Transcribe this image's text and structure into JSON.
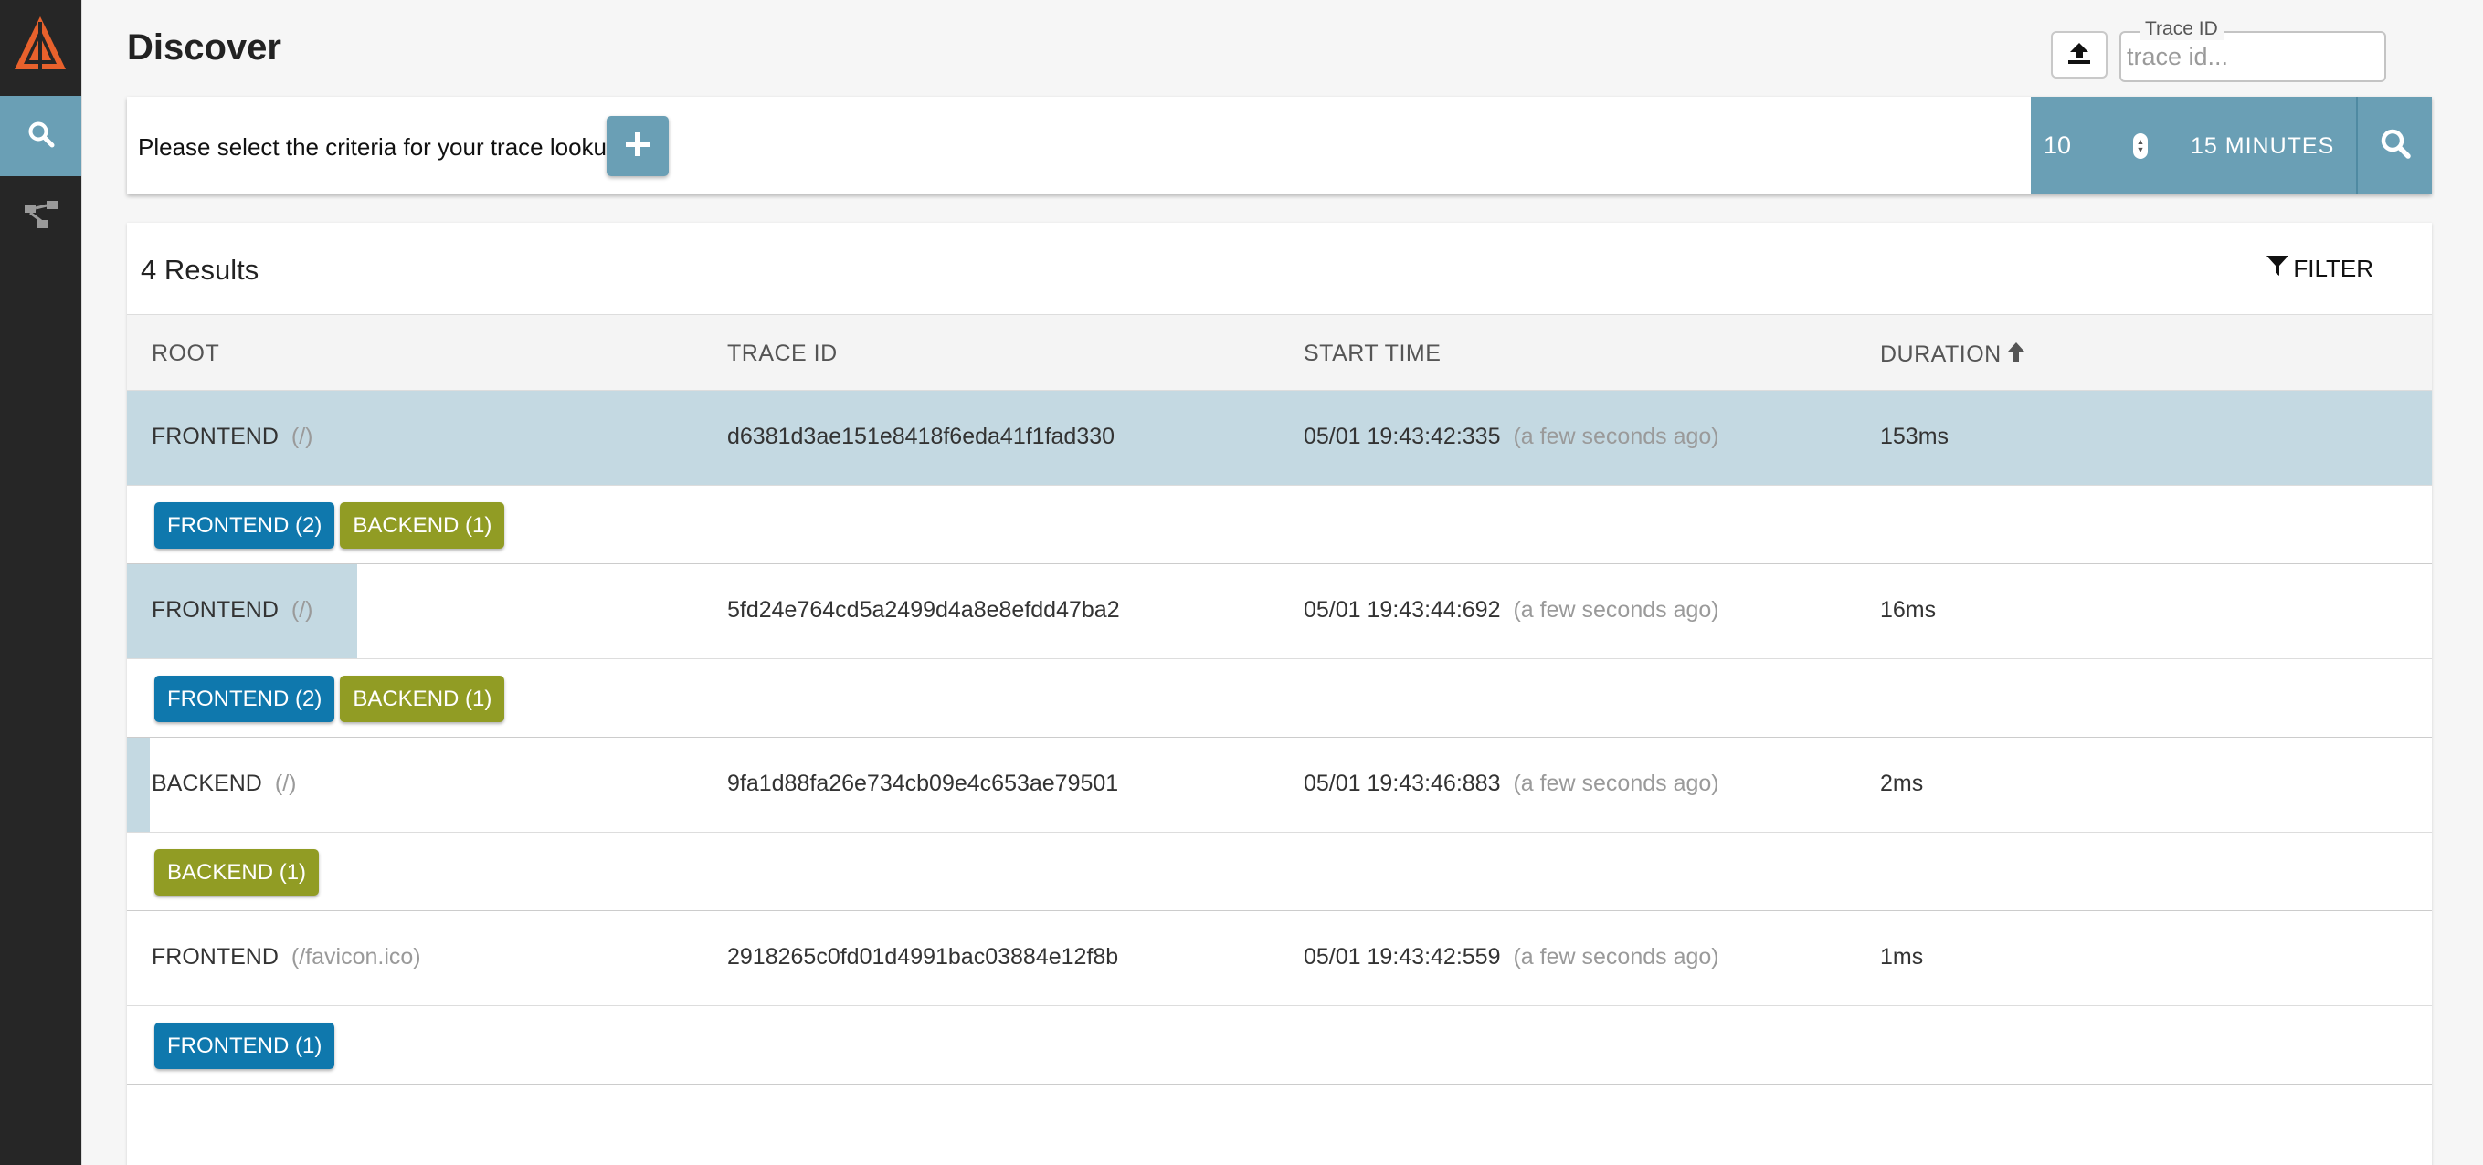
{
  "page": {
    "title": "Discover"
  },
  "sidebar": {
    "items": [
      {
        "name": "discover",
        "icon": "search-icon",
        "active": true
      },
      {
        "name": "dependencies",
        "icon": "dependency-tree-icon",
        "active": false
      }
    ]
  },
  "trace_lookup": {
    "legend": "Trace ID",
    "placeholder": "trace id..."
  },
  "criteria": {
    "prompt": "Please select the criteria for your trace lookup",
    "limit": "10",
    "lookback": "15 MINUTES"
  },
  "results": {
    "count_label": "4 Results",
    "filter_label": "FILTER",
    "columns": {
      "root": "ROOT",
      "trace_id": "TRACE ID",
      "start_time": "START TIME",
      "duration": "DURATION"
    },
    "rows": [
      {
        "service": "FRONTEND",
        "path": "(/)",
        "trace_id": "d6381d3ae151e8418f6eda41f1fad330",
        "start_time": "05/01 19:43:42:335",
        "ago": "(a few seconds ago)",
        "duration": "153ms",
        "duration_fraction": 1.0,
        "tags": [
          {
            "label": "FRONTEND (2)",
            "kind": "frontend"
          },
          {
            "label": "BACKEND (1)",
            "kind": "backend"
          }
        ]
      },
      {
        "service": "FRONTEND",
        "path": "(/)",
        "trace_id": "5fd24e764cd5a2499d4a8e8efdd47ba2",
        "start_time": "05/01 19:43:44:692",
        "ago": "(a few seconds ago)",
        "duration": "16ms",
        "duration_fraction": 0.1,
        "tags": [
          {
            "label": "FRONTEND (2)",
            "kind": "frontend"
          },
          {
            "label": "BACKEND (1)",
            "kind": "backend"
          }
        ]
      },
      {
        "service": "BACKEND",
        "path": "(/)",
        "trace_id": "9fa1d88fa26e734cb09e4c653ae79501",
        "start_time": "05/01 19:43:46:883",
        "ago": "(a few seconds ago)",
        "duration": "2ms",
        "duration_fraction": 0.01,
        "tags": [
          {
            "label": "BACKEND (1)",
            "kind": "backend"
          }
        ]
      },
      {
        "service": "FRONTEND",
        "path": "(/favicon.ico)",
        "trace_id": "2918265c0fd01d4991bac03884e12f8b",
        "start_time": "05/01 19:43:42:559",
        "ago": "(a few seconds ago)",
        "duration": "1ms",
        "duration_fraction": 0.0,
        "tags": [
          {
            "label": "FRONTEND (1)",
            "kind": "frontend"
          }
        ]
      }
    ]
  },
  "colors": {
    "accent": "#6a9fb5",
    "sidebar": "#262626",
    "frontend_tag": "#0f78ad",
    "backend_tag": "#919c24",
    "duration_bar": "#c4d9e2",
    "logo": "#e8612c"
  }
}
